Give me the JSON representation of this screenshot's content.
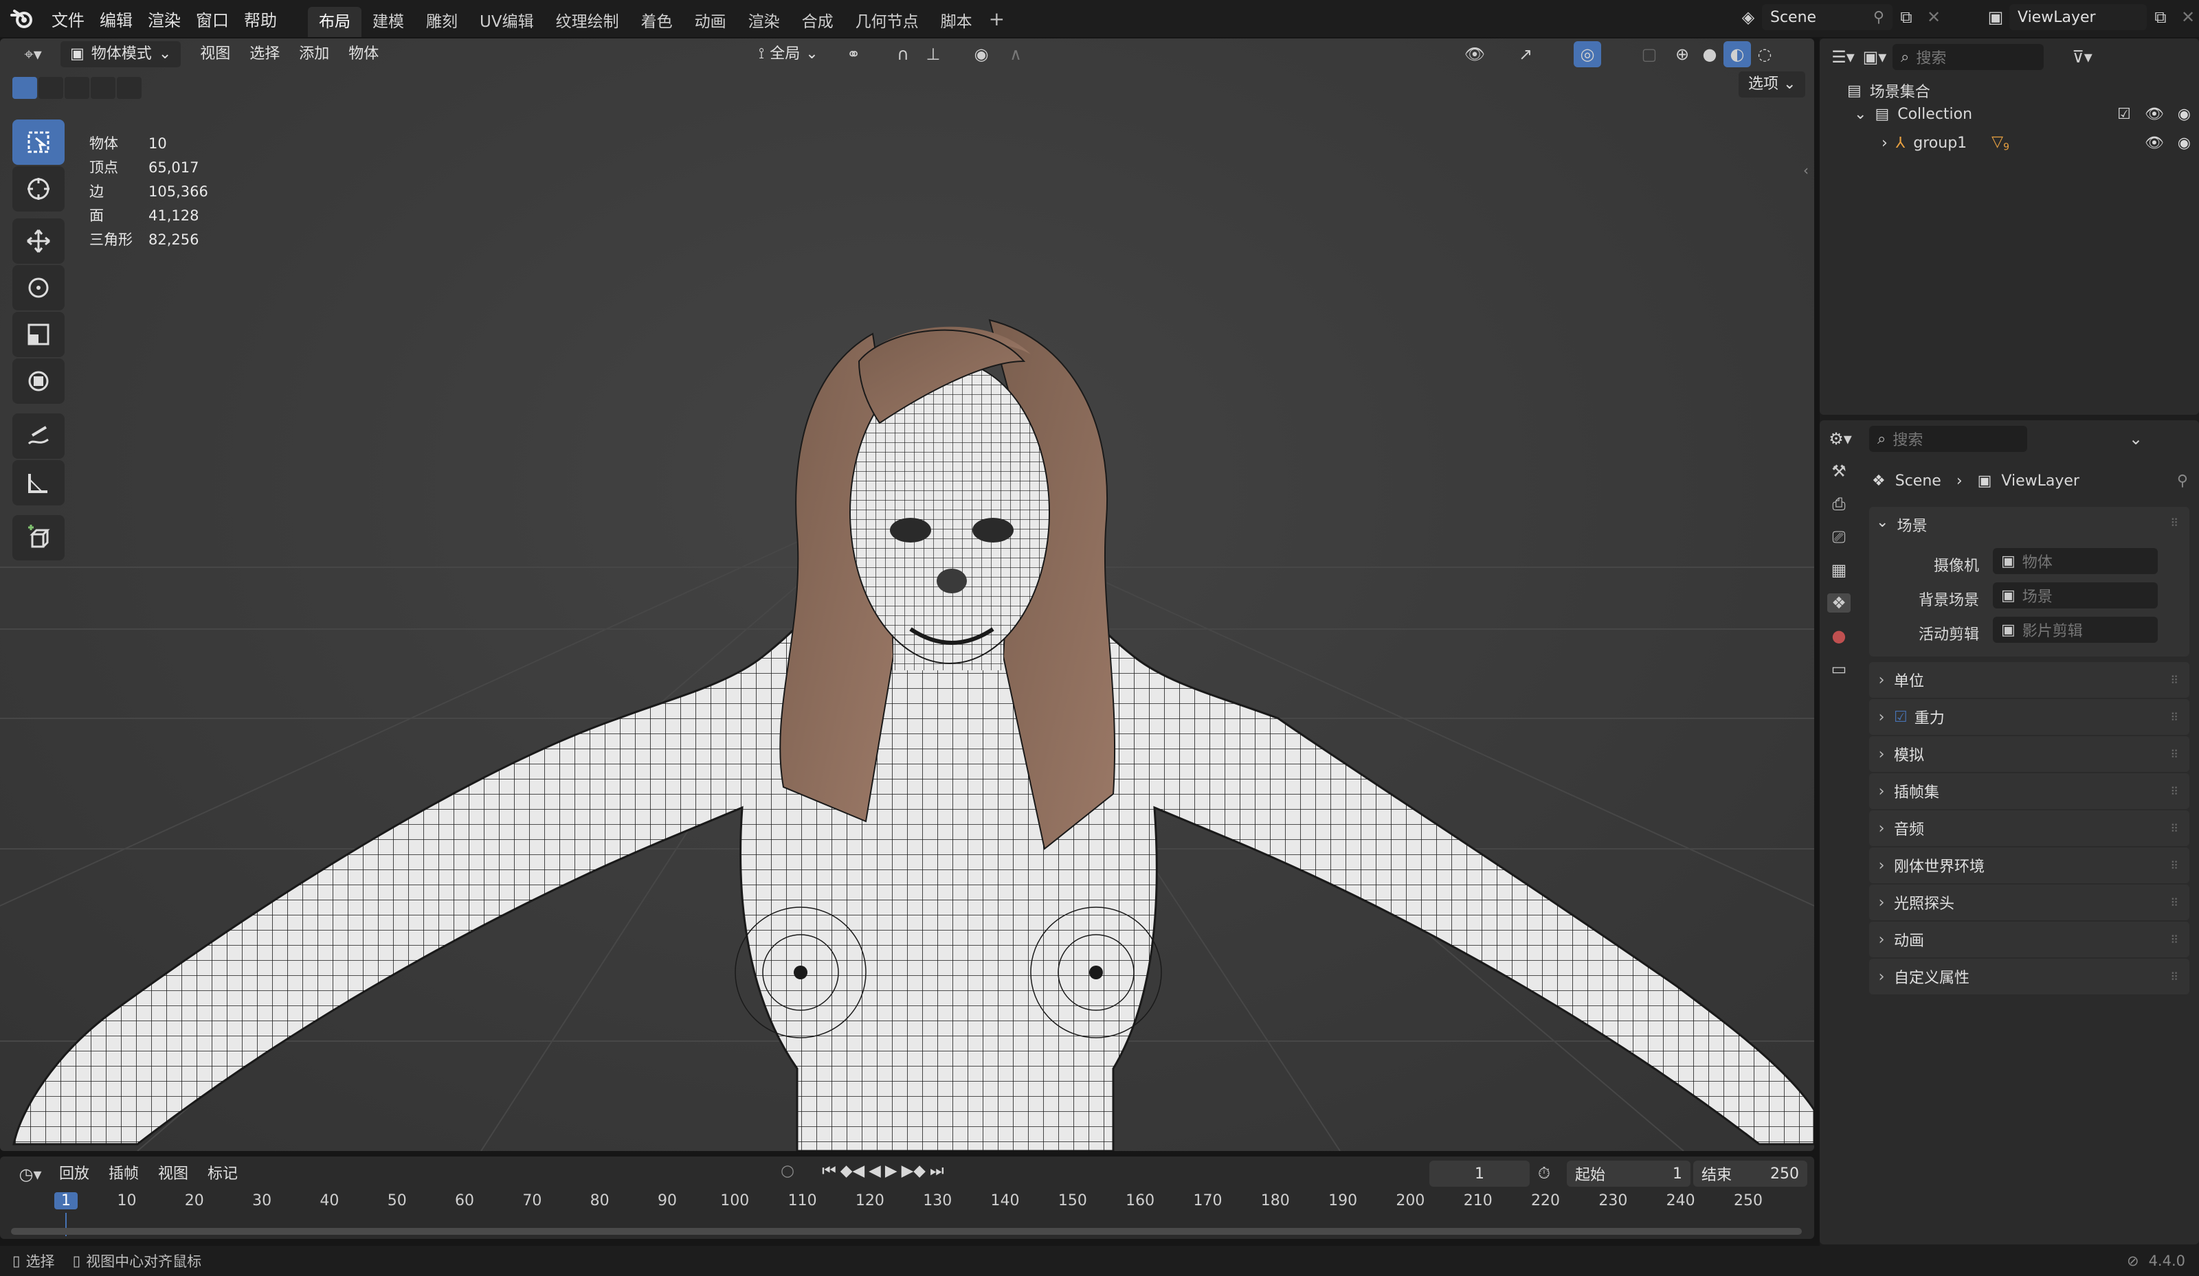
{
  "app": {
    "version": "4.4.0"
  },
  "menu": [
    "文件",
    "编辑",
    "渲染",
    "窗口",
    "帮助"
  ],
  "workspaces": [
    {
      "label": "布局",
      "active": true
    },
    {
      "label": "建模"
    },
    {
      "label": "雕刻"
    },
    {
      "label": "UV编辑"
    },
    {
      "label": "纹理绘制"
    },
    {
      "label": "着色"
    },
    {
      "label": "动画"
    },
    {
      "label": "渲染"
    },
    {
      "label": "合成"
    },
    {
      "label": "几何节点"
    },
    {
      "label": "脚本"
    }
  ],
  "scene_selector": {
    "scene": "Scene",
    "view_layer": "ViewLayer"
  },
  "viewport_header": {
    "mode": "物体模式",
    "menus": [
      "视图",
      "选择",
      "添加",
      "物体"
    ],
    "transform_orientation": "全局",
    "options_label": "选项"
  },
  "stats": [
    {
      "label": "物体",
      "value": "10"
    },
    {
      "label": "顶点",
      "value": "65,017"
    },
    {
      "label": "边",
      "value": "105,366"
    },
    {
      "label": "面",
      "value": "41,128"
    },
    {
      "label": "三角形",
      "value": "82,256"
    }
  ],
  "tools": [
    "select-box",
    "cursor",
    "move",
    "rotate",
    "scale",
    "transform",
    "annotate",
    "measure",
    "add-cube"
  ],
  "outliner": {
    "search_placeholder": "搜索",
    "root": "场景集合",
    "collection": "Collection",
    "child": "group1",
    "child_badge": "9"
  },
  "properties": {
    "search_placeholder": "搜索",
    "breadcrumb": [
      "Scene",
      "ViewLayer"
    ],
    "scene_section": "场景",
    "fields": [
      {
        "label": "摄像机",
        "placeholder": "物体"
      },
      {
        "label": "背景场景",
        "placeholder": "场景"
      },
      {
        "label": "活动剪辑",
        "placeholder": "影片剪辑"
      }
    ],
    "sections": [
      "单位",
      "重力",
      "模拟",
      "插帧集",
      "音频",
      "刚体世界环境",
      "光照探头",
      "动画",
      "自定义属性"
    ]
  },
  "timeline": {
    "menus": [
      "回放",
      "插帧",
      "视图",
      "标记"
    ],
    "current_frame": "1",
    "start_label": "起始",
    "start": "1",
    "end_label": "结束",
    "end": "250",
    "ticks": [
      "1",
      "10",
      "20",
      "30",
      "40",
      "50",
      "60",
      "70",
      "80",
      "90",
      "100",
      "110",
      "120",
      "130",
      "140",
      "150",
      "160",
      "170",
      "180",
      "190",
      "200",
      "210",
      "220",
      "230",
      "240",
      "250"
    ]
  },
  "status": {
    "select": "选择",
    "center": "视图中心对齐鼠标"
  },
  "colors": {
    "accent": "#4772b3",
    "bg": "#1d1d1d",
    "panel": "#2b2b2b"
  }
}
